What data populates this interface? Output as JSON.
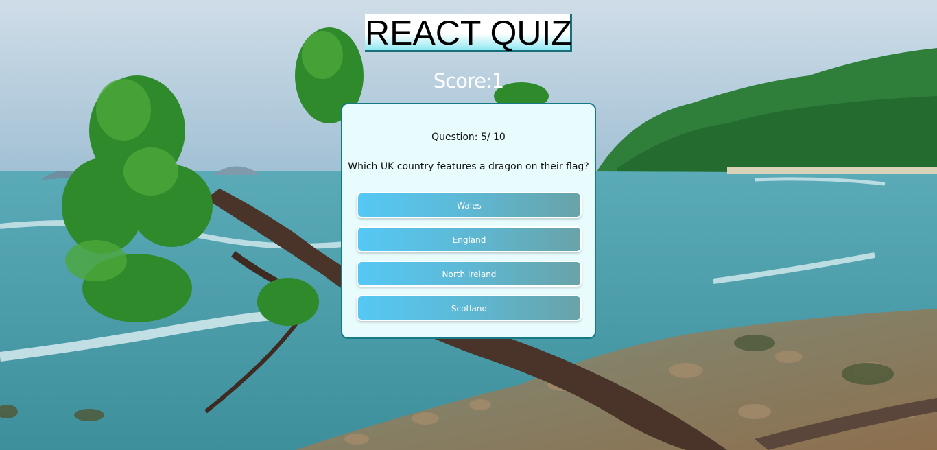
{
  "header": {
    "title": "REACT QUIZ"
  },
  "score": {
    "text": "Score:1"
  },
  "quiz": {
    "question_count": "Question: 5/ 10",
    "question_text": "Which UK country features a dragon on their flag?",
    "answers": [
      {
        "label": "Wales"
      },
      {
        "label": "England"
      },
      {
        "label": "North Ireland"
      },
      {
        "label": "Scotland"
      }
    ]
  },
  "colors": {
    "title_underline": "#1a6f7a",
    "card_background": "#e8fbfd",
    "card_border": "#157a86",
    "answer_gradient_start": "#55c8f5",
    "answer_gradient_end": "#68a3a8"
  }
}
